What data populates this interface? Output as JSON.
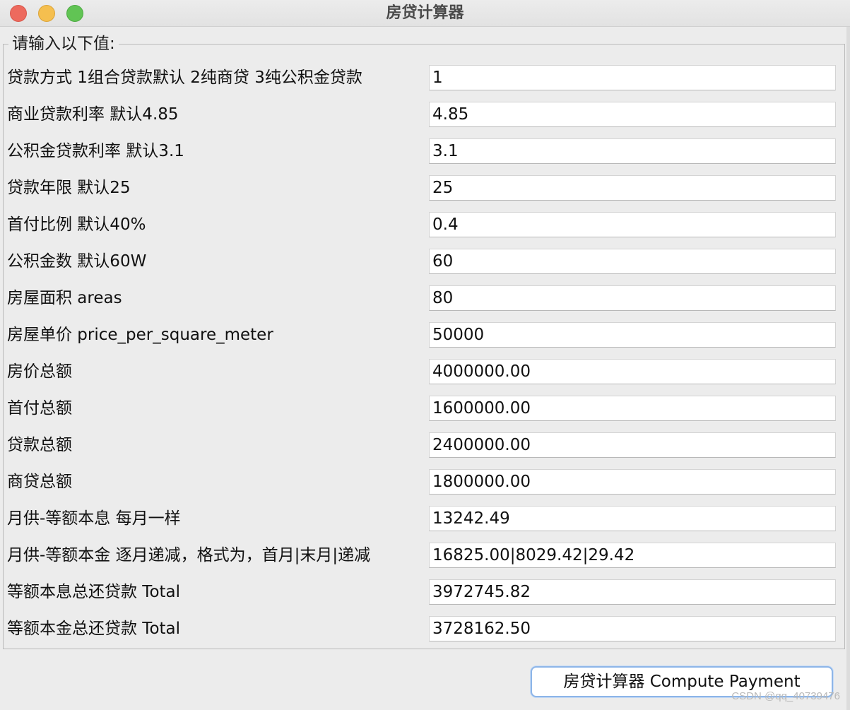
{
  "window": {
    "title": "房贷计算器"
  },
  "group": {
    "legend": "请输入以下值:"
  },
  "rows": [
    {
      "label": "贷款方式 1组合贷款默认 2纯商贷 3纯公积金贷款",
      "value": "1"
    },
    {
      "label": "商业贷款利率 默认4.85",
      "value": "4.85"
    },
    {
      "label": "公积金贷款利率 默认3.1",
      "value": "3.1"
    },
    {
      "label": "贷款年限 默认25",
      "value": "25"
    },
    {
      "label": "首付比例 默认40%",
      "value": "0.4"
    },
    {
      "label": "公积金数 默认60W",
      "value": "60"
    },
    {
      "label": "房屋面积 areas",
      "value": "80"
    },
    {
      "label": "房屋单价 price_per_square_meter",
      "value": "50000"
    },
    {
      "label": "房价总额",
      "value": "4000000.00"
    },
    {
      "label": "首付总额",
      "value": "1600000.00"
    },
    {
      "label": "贷款总额",
      "value": "2400000.00"
    },
    {
      "label": "商贷总额",
      "value": "1800000.00"
    },
    {
      "label": "月供-等额本息 每月一样",
      "value": "13242.49"
    },
    {
      "label": "月供-等额本金 逐月递减，格式为，首月|末月|递减",
      "value": "16825.00|8029.42|29.42"
    },
    {
      "label": "等额本息总还贷款 Total",
      "value": "3972745.82"
    },
    {
      "label": "等额本金总还贷款 Total",
      "value": "3728162.50"
    }
  ],
  "button": {
    "label": "房贷计算器 Compute Payment"
  },
  "watermark": "CSDN @qq_40739476",
  "colors": {
    "close": "#ed6a5e",
    "minimize": "#f5bf4f",
    "maximize": "#61c454",
    "button_border": "#8db5e8"
  }
}
